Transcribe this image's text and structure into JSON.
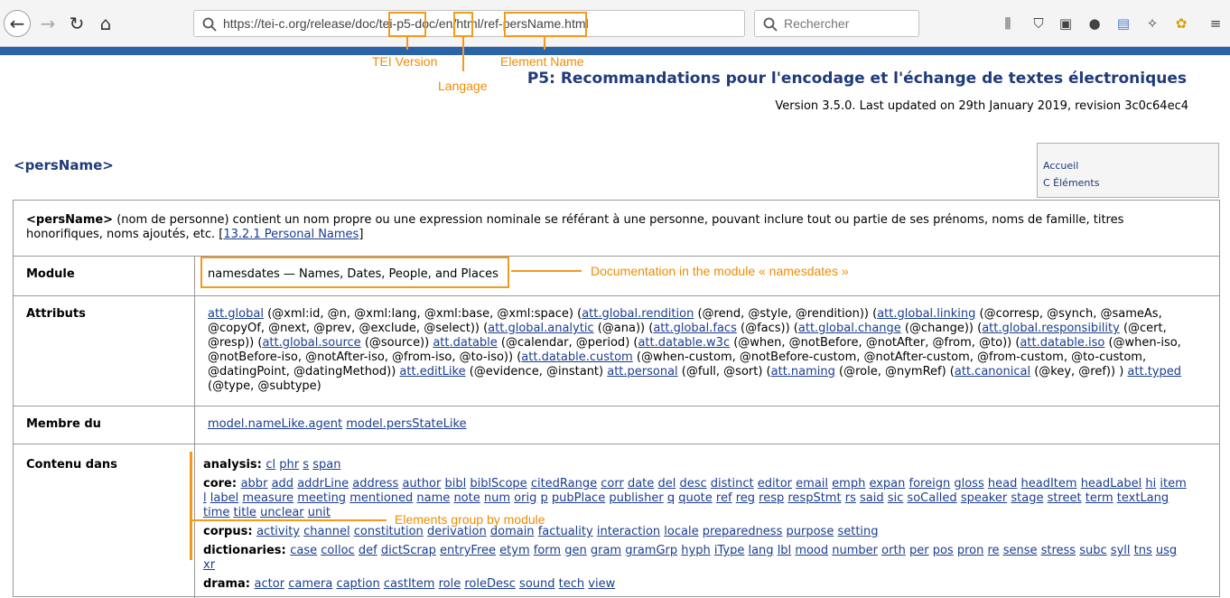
{
  "browser": {
    "url": "https://tei-c.org/release/doc/tei-p5-doc/en/html/ref-persName.html",
    "search_placeholder": "Rechercher"
  },
  "annotations": {
    "tei_version": "TEI Version",
    "language": "Langage",
    "element_name": "Element Name",
    "module_doc": "Documentation in the module « namesdates »",
    "groups": "Elements group by module"
  },
  "header": {
    "title": "P5: Recommandations pour l'encodage et l'échange de textes électroniques",
    "version": "Version 3.5.0. Last updated on 29th January 2019, revision 3c0c64ec4"
  },
  "element": {
    "name": "<persName>"
  },
  "sidenav": {
    "items": [
      "Accueil",
      "C Éléments"
    ]
  },
  "description": {
    "name": "<persName>",
    "text": " (nom de personne) contient un nom propre ou une expression nominale se référant à une personne, pouvant inclure tout ou partie de ses prénoms, noms de famille, titres honorifiques, noms ajoutés, etc. [",
    "link": "13.2.1 Personal Names",
    "tail": "]"
  },
  "module": {
    "label": "Module",
    "value": "namesdates — Names, Dates, People, and Places"
  },
  "attributs": {
    "label": "Attributs",
    "text": [
      [
        "att.global",
        " (@xml:id, @n, @xml:lang, @xml:base, @xml:space) ("
      ],
      [
        "att.global.rendition",
        " (@rend, @style, @rendition)) ("
      ],
      [
        "att.global.linking",
        " (@corresp, @synch, @sameAs, @copyOf, @next, @prev, @exclude, @select)) ("
      ],
      [
        "att.global.analytic",
        " (@ana)) ("
      ],
      [
        "att.global.facs",
        " (@facs)) ("
      ],
      [
        "att.global.change",
        " (@change)) ("
      ],
      [
        "att.global.responsibility",
        " (@cert, @resp)) ("
      ],
      [
        "att.global.source",
        " (@source)) "
      ],
      [
        "att.datable",
        " (@calendar, @period) ("
      ],
      [
        "att.datable.w3c",
        " (@when, @notBefore, @notAfter, @from, @to)) ("
      ],
      [
        "att.datable.iso",
        " (@when-iso, @notBefore-iso, @notAfter-iso, @from-iso, @to-iso)) ("
      ],
      [
        "att.datable.custom",
        " (@when-custom, @notBefore-custom, @notAfter-custom, @from-custom, @to-custom, @datingPoint, @datingMethod)) "
      ],
      [
        "att.editLike",
        " (@evidence, @instant) "
      ],
      [
        "att.personal",
        " (@full, @sort) ("
      ],
      [
        "att.naming",
        " (@role, @nymRef) ("
      ],
      [
        "att.canonical",
        " (@key, @ref)) ) "
      ],
      [
        "att.typed",
        " (@type, @subtype)"
      ]
    ]
  },
  "membre": {
    "label": "Membre du",
    "links": [
      "model.nameLike.agent",
      "model.persStateLike"
    ]
  },
  "contenu": {
    "label": "Contenu dans",
    "groups": [
      {
        "name": "analysis:",
        "items": [
          "cl",
          "phr",
          "s",
          "span"
        ]
      },
      {
        "name": "core:",
        "items": [
          "abbr",
          "add",
          "addrLine",
          "address",
          "author",
          "bibl",
          "biblScope",
          "citedRange",
          "corr",
          "date",
          "del",
          "desc",
          "distinct",
          "editor",
          "email",
          "emph",
          "expan",
          "foreign",
          "gloss",
          "head",
          "headItem",
          "headLabel",
          "hi",
          "item",
          "l",
          "label",
          "measure",
          "meeting",
          "mentioned",
          "name",
          "note",
          "num",
          "orig",
          "p",
          "pubPlace",
          "publisher",
          "q",
          "quote",
          "ref",
          "reg",
          "resp",
          "respStmt",
          "rs",
          "said",
          "sic",
          "soCalled",
          "speaker",
          "stage",
          "street",
          "term",
          "textLang",
          "time",
          "title",
          "unclear",
          "unit"
        ]
      },
      {
        "name": "corpus:",
        "items": [
          "activity",
          "channel",
          "constitution",
          "derivation",
          "domain",
          "factuality",
          "interaction",
          "locale",
          "preparedness",
          "purpose",
          "setting"
        ]
      },
      {
        "name": "dictionaries:",
        "items": [
          "case",
          "colloc",
          "def",
          "dictScrap",
          "entryFree",
          "etym",
          "form",
          "gen",
          "gram",
          "gramGrp",
          "hyph",
          "iType",
          "lang",
          "lbl",
          "mood",
          "number",
          "orth",
          "per",
          "pos",
          "pron",
          "re",
          "sense",
          "stress",
          "subc",
          "syll",
          "tns",
          "usg",
          "xr"
        ]
      },
      {
        "name": "drama:",
        "items": [
          "actor",
          "camera",
          "caption",
          "castItem",
          "role",
          "roleDesc",
          "sound",
          "tech",
          "view"
        ]
      }
    ]
  }
}
